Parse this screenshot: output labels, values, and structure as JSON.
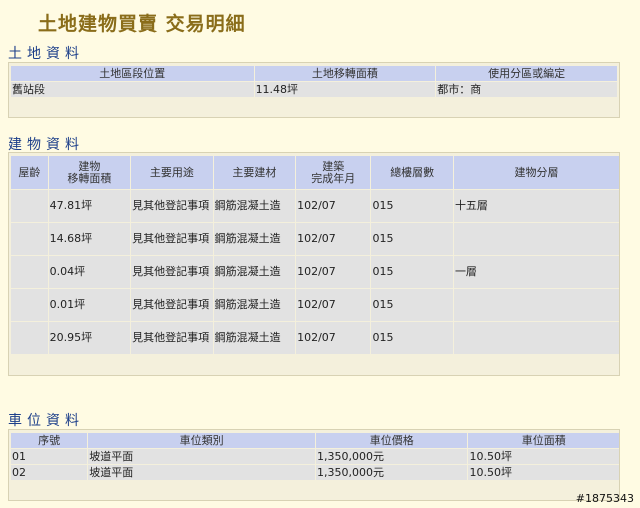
{
  "page": {
    "title": "土地建物買賣 交易明細"
  },
  "land": {
    "section_title": "土地資料",
    "headers": [
      "土地區段位置",
      "土地移轉面積",
      "使用分區或編定"
    ],
    "rows": [
      [
        "舊站段",
        "11.48坪",
        "都市：商"
      ]
    ]
  },
  "building": {
    "section_title": "建物資料",
    "headers": [
      "屋齡",
      "建物\n移轉面積",
      "主要用途",
      "主要建材",
      "建築\n完成年月",
      "總樓層數",
      "建物分層"
    ],
    "rows": [
      [
        "",
        "47.81坪",
        "見其他登記事項",
        "鋼筋混凝土造",
        "102/07",
        "015",
        "十五層"
      ],
      [
        "",
        "14.68坪",
        "見其他登記事項",
        "鋼筋混凝土造",
        "102/07",
        "015",
        ""
      ],
      [
        "",
        "0.04坪",
        "見其他登記事項",
        "鋼筋混凝土造",
        "102/07",
        "015",
        "一層"
      ],
      [
        "",
        "0.01坪",
        "見其他登記事項",
        "鋼筋混凝土造",
        "102/07",
        "015",
        ""
      ],
      [
        "",
        "20.95坪",
        "見其他登記事項",
        "鋼筋混凝土造",
        "102/07",
        "015",
        ""
      ]
    ]
  },
  "parking": {
    "section_title": "車位資料",
    "headers": [
      "序號",
      "車位類別",
      "車位價格",
      "車位面積"
    ],
    "rows": [
      [
        "01",
        "坡道平面",
        "1,350,000元",
        "10.50坪"
      ],
      [
        "02",
        "坡道平面",
        "1,350,000元",
        "10.50坪"
      ]
    ]
  },
  "watermark": "#1875343"
}
